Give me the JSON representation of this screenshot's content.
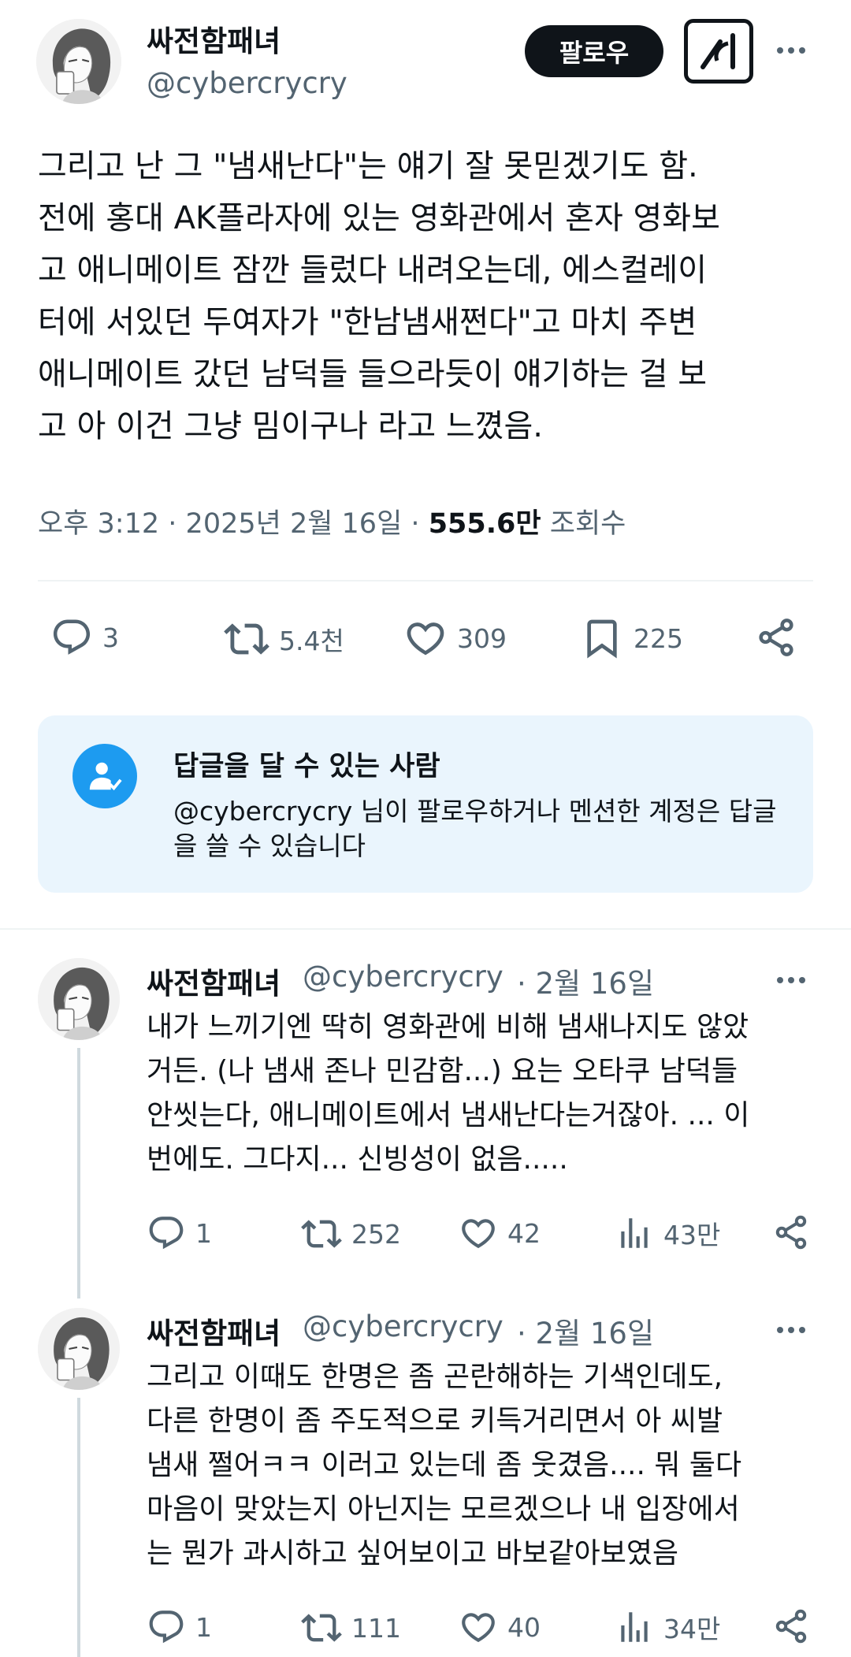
{
  "main_tweet": {
    "display_name": "싸전함패녀",
    "handle": "@cybercrycry",
    "follow_label": "팔로우",
    "text": "그리고 난 그 \"냄새난다\"는 얘기 잘 못믿겠기도 함.\n전에 홍대 AK플라자에 있는 영화관에서 혼자 영화보\n고 애니메이트 잠깐 들렀다 내려오는데, 에스컬레이\n터에 서있던 두여자가 \"한남냄새쩐다\"고 마치 주변\n애니메이트 갔던 남덕들 들으라듯이 얘기하는 걸 보\n고 아 이건 그냥 밈이구나 라고 느꼈음.",
    "time": "오후 3:12",
    "date": "2025년 2월 16일",
    "views_value": "555.6만",
    "views_label": "조회수",
    "sep": "·",
    "stats": {
      "replies": "3",
      "retweets": "5.4천",
      "likes": "309",
      "bookmarks": "225"
    }
  },
  "reply_restriction": {
    "title": "답글을 달 수 있는 사람",
    "description": "@cybercrycry 님이 팔로우하거나 멘션한 계정은 답글을 쓸 수 있습니다"
  },
  "replies": [
    {
      "display_name": "싸전함패녀",
      "handle": "@cybercrycry",
      "date": "· 2월 16일",
      "text": "내가 느끼기엔 딱히 영화관에 비해 냄새나지도 않았\n거든. (나 냄새 존나 민감함...) 요는 오타쿠 남덕들\n안씻는다, 애니메이트에서 냄새난다는거잖아. ... 이\n번에도. 그다지... 신빙성이 없음.....",
      "stats": {
        "replies": "1",
        "retweets": "252",
        "likes": "42",
        "views": "43만"
      }
    },
    {
      "display_name": "싸전함패녀",
      "handle": "@cybercrycry",
      "date": "· 2월 16일",
      "text": "그리고 이때도 한명은 좀 곤란해하는 기색인데도,\n다른 한명이 좀 주도적으로 키득거리면서 아 씨발\n냄새 쩔어ㅋㅋ 이러고 있는데 좀 웃겼음.... 뭐 둘다\n마음이 맞았는지 아닌지는 모르겠으나 내 입장에서\n는 뭔가 과시하고 싶어보이고 바보같아보였음",
      "stats": {
        "replies": "1",
        "retweets": "111",
        "likes": "40",
        "views": "34만"
      }
    }
  ],
  "colors": {
    "text": "#0f1419",
    "muted": "#536471",
    "divider": "#eff3f4",
    "accent": "#1d9bf0",
    "reply_box_bg": "#eaf5fd"
  },
  "icons": [
    "more-icon",
    "grok-icon",
    "reply-icon",
    "retweet-icon",
    "like-icon",
    "bookmark-icon",
    "share-icon",
    "views-icon",
    "person-check-icon"
  ]
}
